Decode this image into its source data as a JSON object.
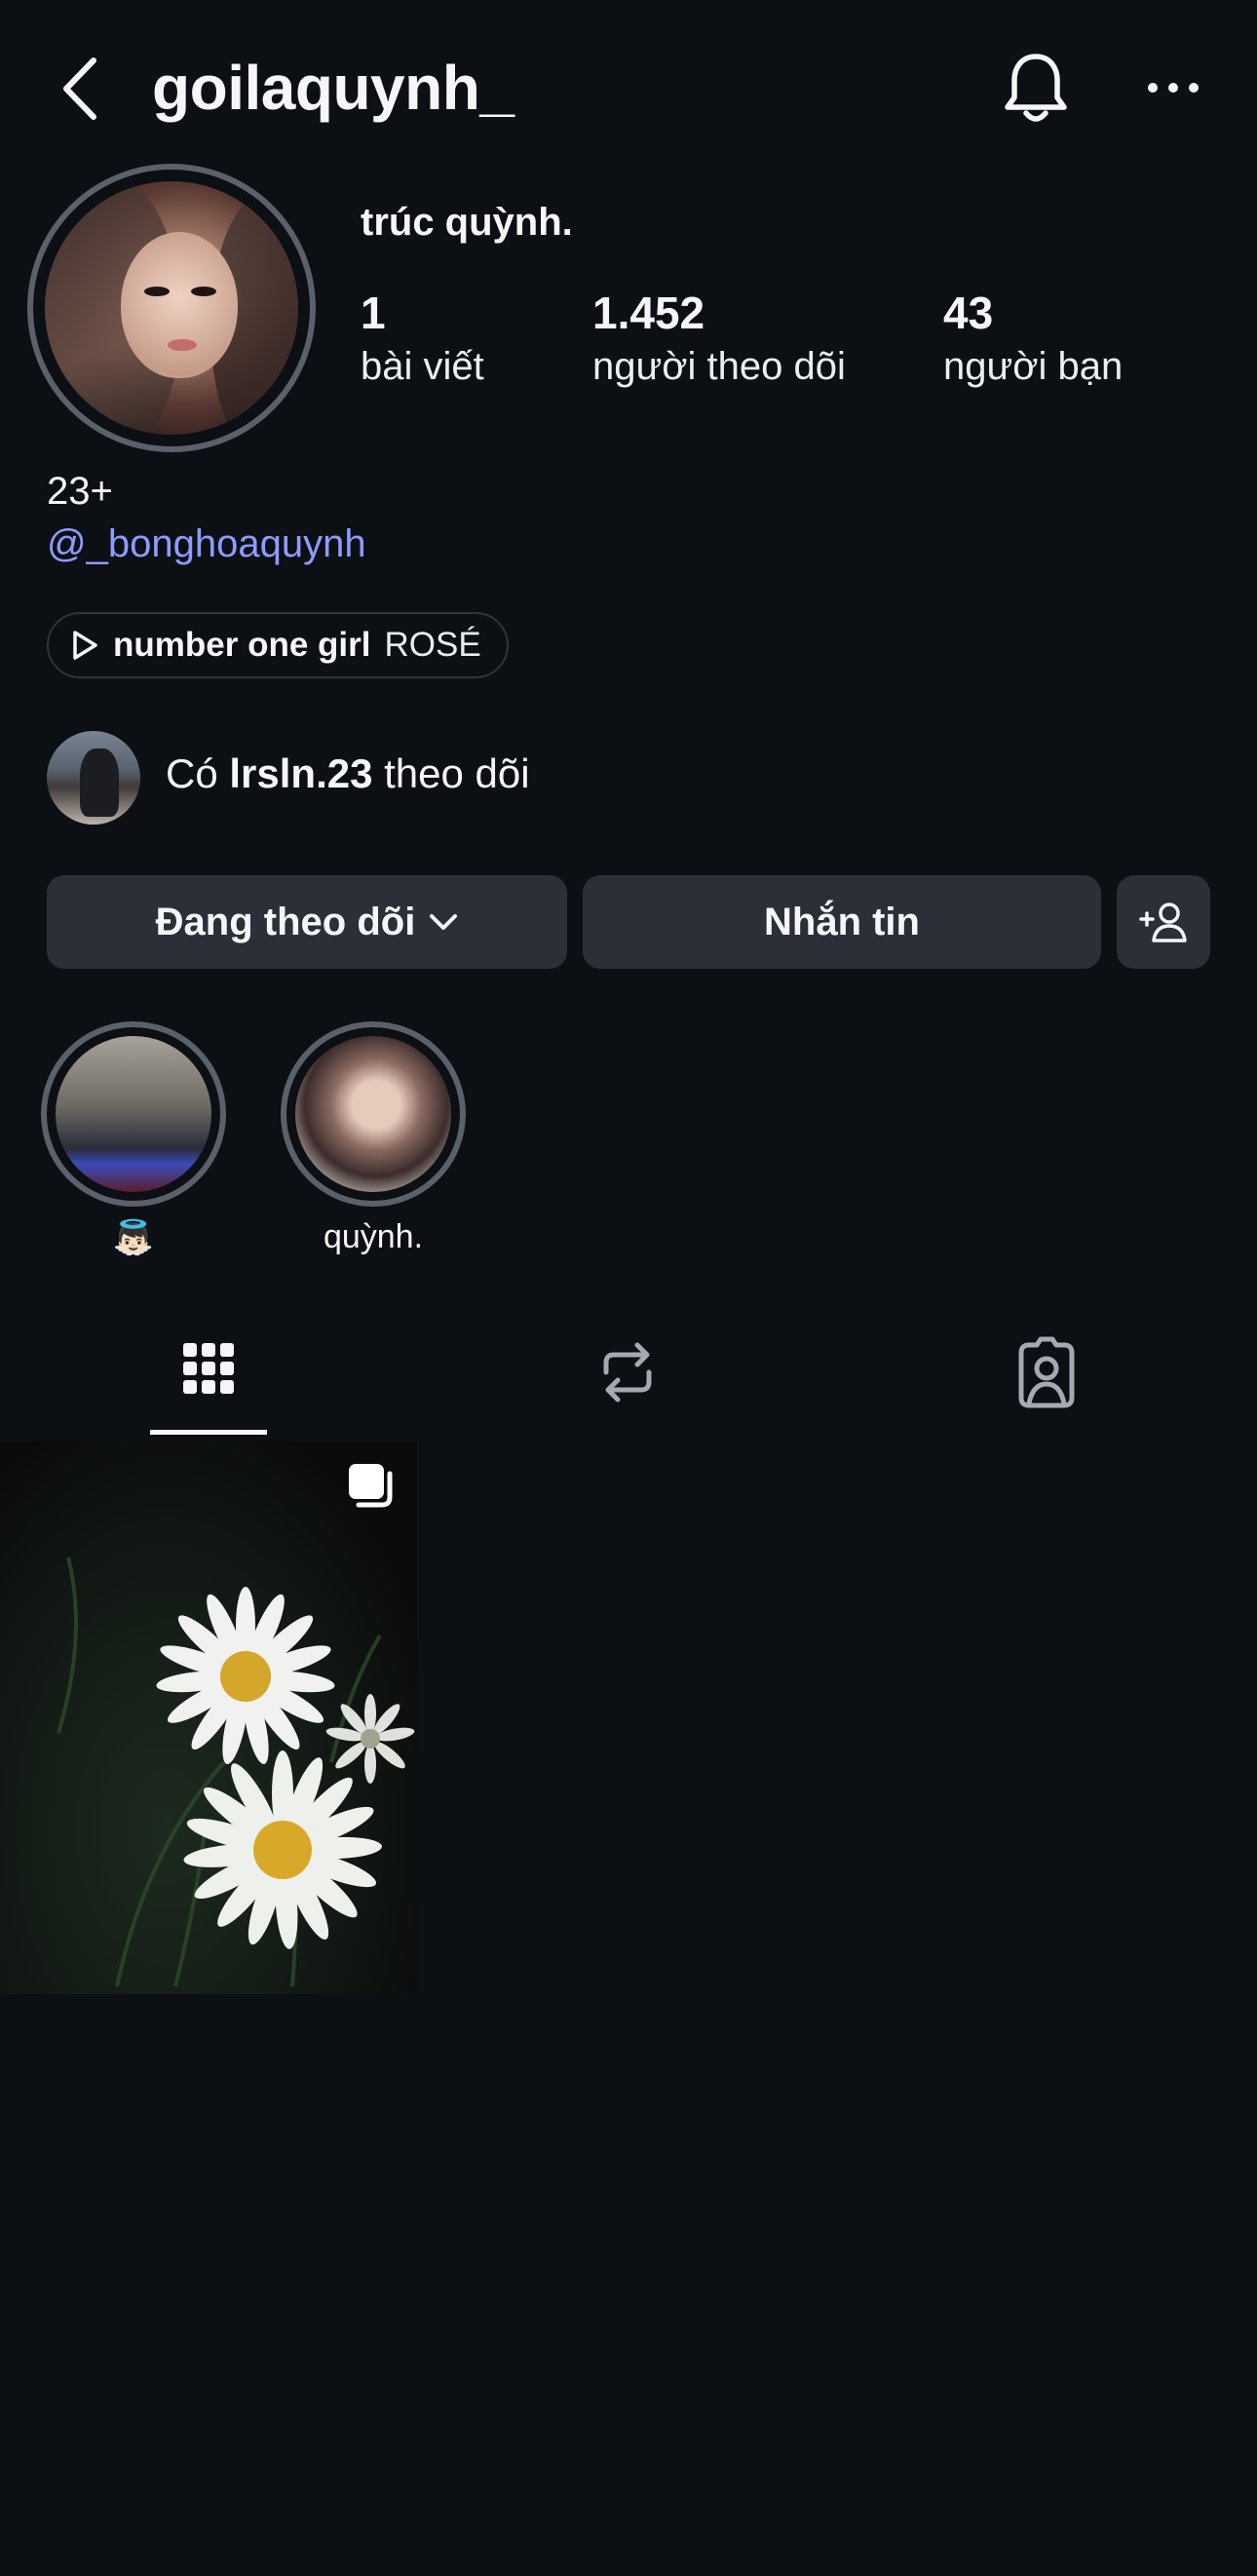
{
  "header": {
    "username": "goilaquynh_",
    "back_icon": "chevron-left-icon",
    "bell_icon": "bell-icon",
    "more_icon": "more-horizontal-icon"
  },
  "profile": {
    "display_name": "trúc quỳnh.",
    "stats": [
      {
        "value": "1",
        "label": "bài viết"
      },
      {
        "value": "1.452",
        "label": "người theo dõi"
      },
      {
        "value": "43",
        "label": "người bạn"
      }
    ],
    "bio_line": "23+",
    "bio_link": "@_bonghoaquynh"
  },
  "music": {
    "song": "number one girl",
    "artist": "ROSÉ"
  },
  "followed_by": {
    "prefix": "Có",
    "user": "lrsln.23",
    "suffix": "theo dõi"
  },
  "actions": {
    "following_label": "Đang theo dõi",
    "message_label": "Nhắn tin"
  },
  "highlights": [
    {
      "label": "👼🏻"
    },
    {
      "label": "quỳnh."
    }
  ],
  "tabs": [
    "grid-icon",
    "repost-icon",
    "tagged-icon"
  ],
  "colors": {
    "background": "#0c0f14",
    "button": "#2b3038",
    "link": "#8f9bff",
    "ring": "#5b616b"
  }
}
